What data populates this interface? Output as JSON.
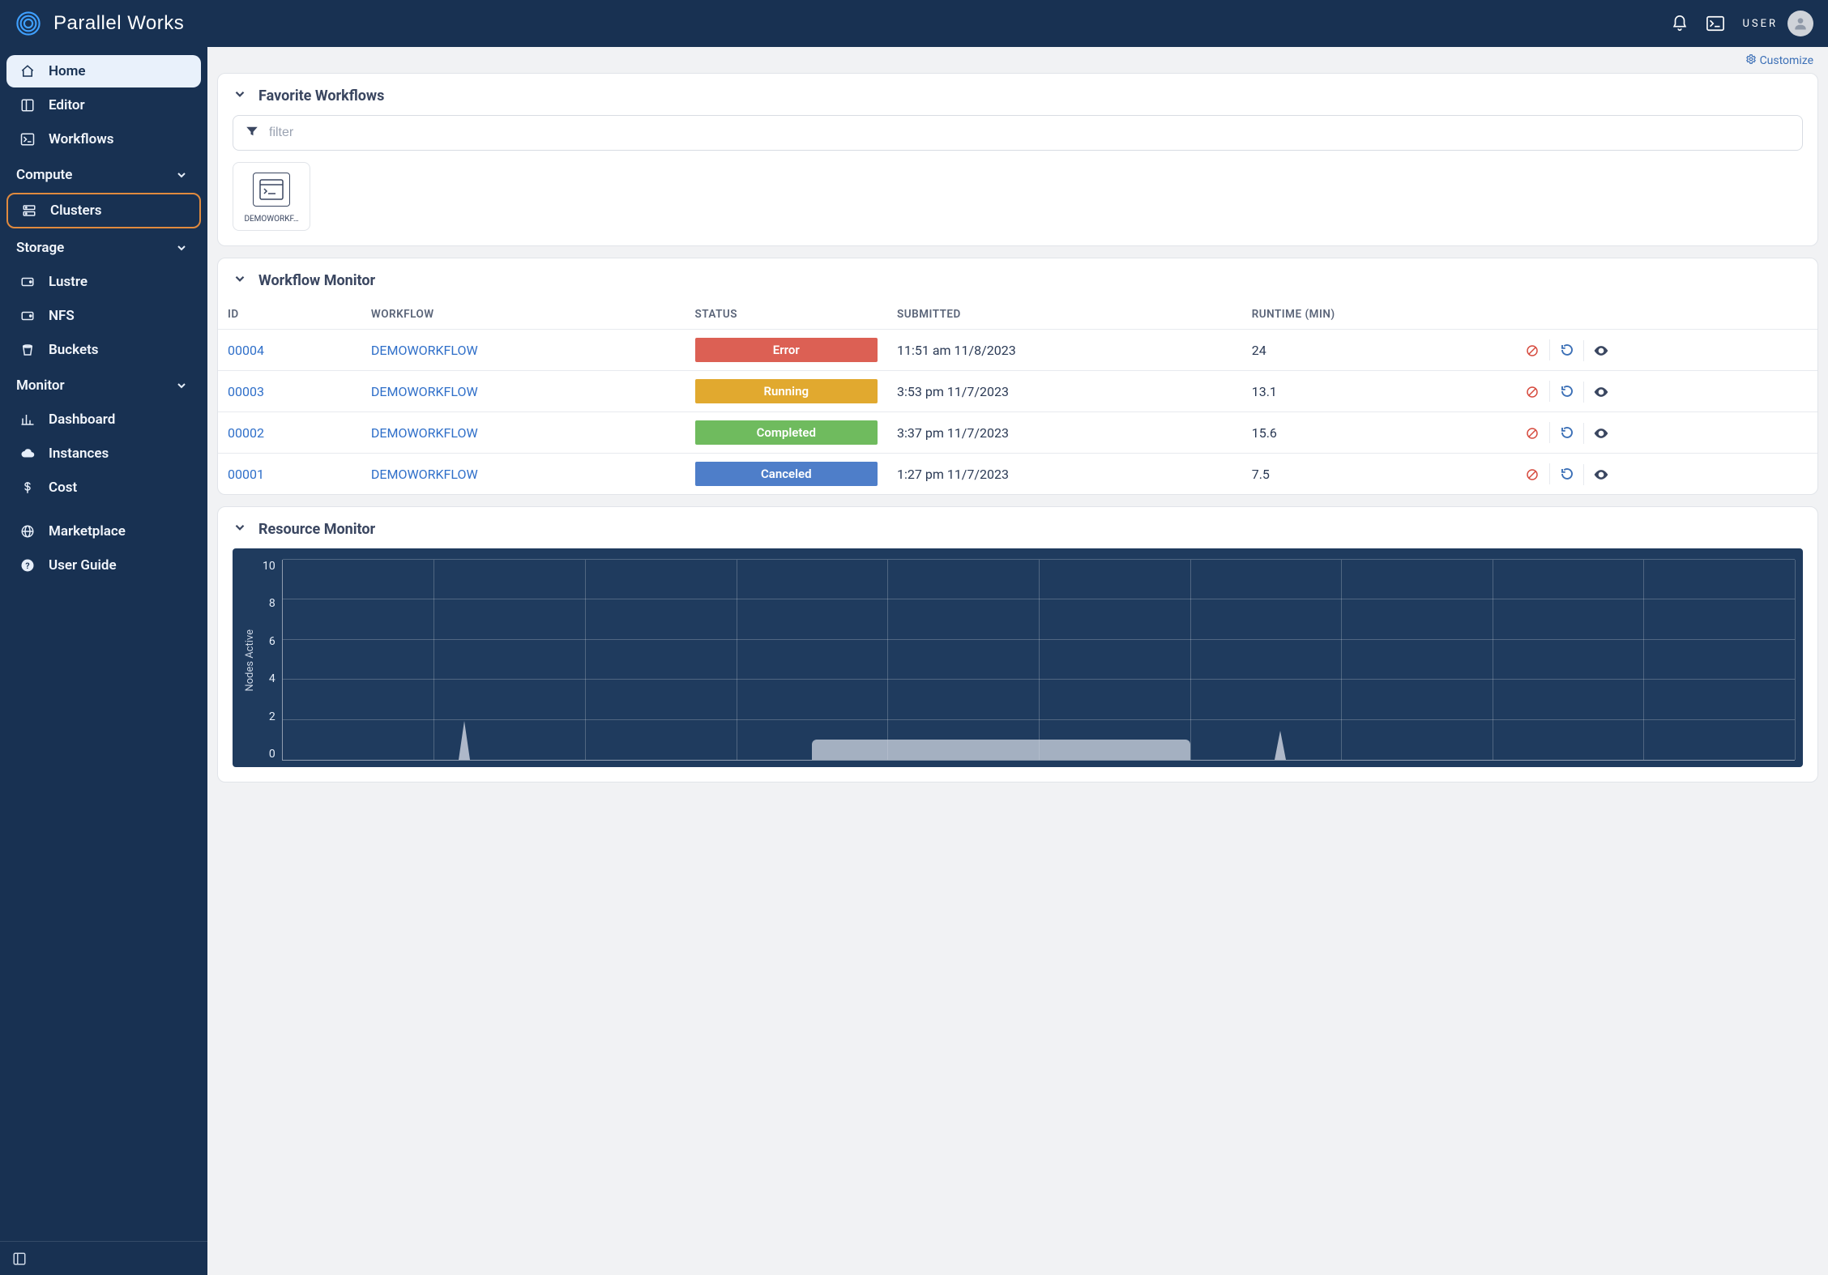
{
  "brand": "Parallel Works",
  "topbar": {
    "username": "USER"
  },
  "sidebar": {
    "items": [
      {
        "key": "home",
        "label": "Home",
        "icon": "home-icon",
        "active": true,
        "highlight": false
      },
      {
        "key": "editor",
        "label": "Editor",
        "icon": "layout-icon",
        "active": false,
        "highlight": false
      },
      {
        "key": "workflows",
        "label": "Workflows",
        "icon": "terminal-icon",
        "active": false,
        "highlight": false
      }
    ],
    "sections": [
      {
        "title": "Compute",
        "items": [
          {
            "key": "clusters",
            "label": "Clusters",
            "icon": "server-icon",
            "highlight": true
          }
        ]
      },
      {
        "title": "Storage",
        "items": [
          {
            "key": "lustre",
            "label": "Lustre",
            "icon": "disk-icon"
          },
          {
            "key": "nfs",
            "label": "NFS",
            "icon": "disk-icon"
          },
          {
            "key": "buckets",
            "label": "Buckets",
            "icon": "bucket-icon"
          }
        ]
      },
      {
        "title": "Monitor",
        "items": [
          {
            "key": "dashboard",
            "label": "Dashboard",
            "icon": "barchart-icon"
          },
          {
            "key": "instances",
            "label": "Instances",
            "icon": "cloud-icon"
          },
          {
            "key": "cost",
            "label": "Cost",
            "icon": "dollar-icon"
          }
        ]
      }
    ],
    "footer_items": [
      {
        "key": "marketplace",
        "label": "Marketplace",
        "icon": "globe-icon"
      },
      {
        "key": "userguide",
        "label": "User Guide",
        "icon": "help-icon"
      }
    ]
  },
  "customize_label": "Customize",
  "favorites": {
    "title": "Favorite Workflows",
    "filter_placeholder": "filter",
    "cards": [
      {
        "label": "DEMOWORKF…"
      }
    ]
  },
  "workflow_monitor": {
    "title": "Workflow Monitor",
    "columns": [
      "ID",
      "WORKFLOW",
      "STATUS",
      "SUBMITTED",
      "RUNTIME (MIN)"
    ],
    "rows": [
      {
        "id": "00004",
        "workflow": "DEMOWORKFLOW",
        "status": "Error",
        "status_class": "status-error",
        "submitted": "11:51 am 11/8/2023",
        "runtime": "24"
      },
      {
        "id": "00003",
        "workflow": "DEMOWORKFLOW",
        "status": "Running",
        "status_class": "status-running",
        "submitted": "3:53 pm 11/7/2023",
        "runtime": "13.1"
      },
      {
        "id": "00002",
        "workflow": "DEMOWORKFLOW",
        "status": "Completed",
        "status_class": "status-completed",
        "submitted": "3:37 pm 11/7/2023",
        "runtime": "15.6"
      },
      {
        "id": "00001",
        "workflow": "DEMOWORKFLOW",
        "status": "Canceled",
        "status_class": "status-canceled",
        "submitted": "1:27 pm 11/7/2023",
        "runtime": "7.5"
      }
    ]
  },
  "resource_monitor": {
    "title": "Resource Monitor"
  },
  "chart_data": {
    "type": "area",
    "ylabel": "Nodes Active",
    "ylim": [
      0,
      10
    ],
    "yticks": [
      0,
      2,
      4,
      6,
      8,
      10
    ],
    "grid": true,
    "x_gridlines": 10,
    "series": [
      {
        "name": "nodes-active",
        "segments": [
          {
            "type": "spike",
            "x_percent": 12,
            "peak_value": 2
          },
          {
            "type": "plateau",
            "x_start_percent": 35,
            "x_end_percent": 60,
            "value": 1
          },
          {
            "type": "spike",
            "x_percent": 66,
            "peak_value": 1.5
          }
        ]
      }
    ]
  }
}
